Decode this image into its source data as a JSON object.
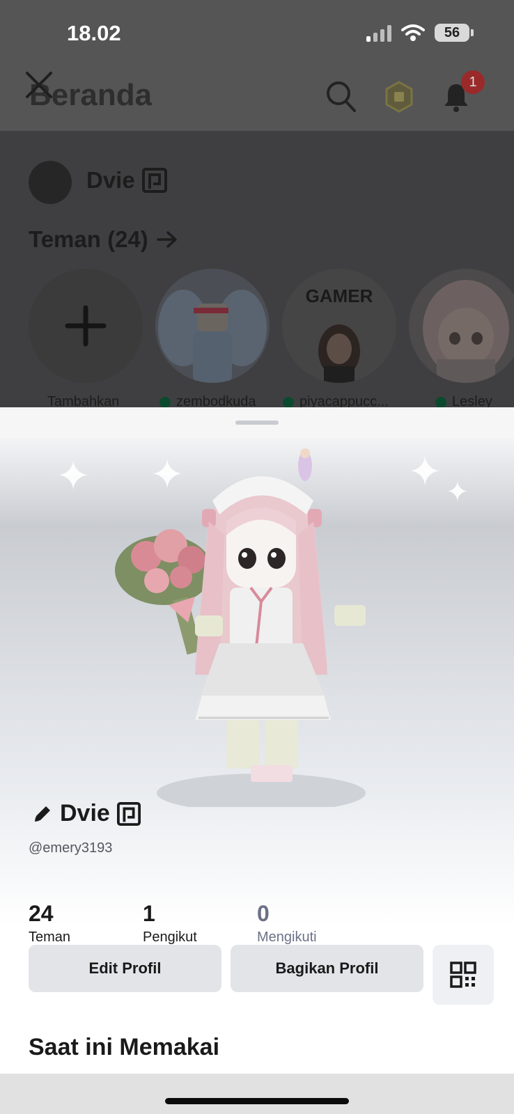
{
  "status_bar": {
    "time": "18.02",
    "battery": "56"
  },
  "background": {
    "title": "Beranda",
    "notification_count": "1",
    "user_name": "Dvie",
    "friends_header": "Teman (24)",
    "friends": [
      {
        "label": "Tambahkan",
        "online": false
      },
      {
        "label": "zembodkuda",
        "online": true
      },
      {
        "label": "piyacappucc...",
        "online": true
      },
      {
        "label": "Lesley",
        "online": true
      }
    ],
    "friend_art_text": {
      "gamer_label": "GAMER"
    }
  },
  "profile": {
    "display_name": "Dvie",
    "username": "@emery3193",
    "stats": [
      {
        "value": "24",
        "label": "Teman"
      },
      {
        "value": "1",
        "label": "Pengikut"
      },
      {
        "value": "0",
        "label": "Mengikuti"
      }
    ],
    "buttons": {
      "edit": "Edit Profil",
      "share": "Bagikan Profil"
    },
    "section_title": "Saat ini Memakai"
  },
  "colors": {
    "overlay": "#3f3f41",
    "button_bg": "#e3e4e8",
    "muted_text": "#6b7086",
    "badge": "#9a2a2a"
  },
  "icons": [
    "close-icon",
    "search-icon",
    "robux-icon",
    "bell-icon",
    "premium-icon",
    "arrow-right-icon",
    "plus-icon",
    "pencil-icon",
    "qr-code-icon"
  ]
}
